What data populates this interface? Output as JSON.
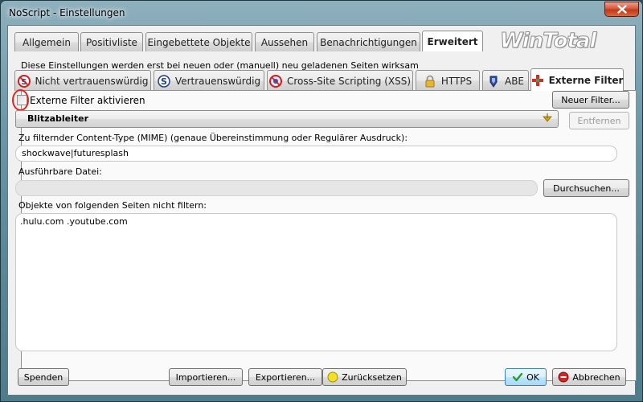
{
  "window": {
    "title": "NoScript - Einstellungen",
    "close_icon": "close-icon"
  },
  "logo_text": "WinTotal",
  "main_tabs": [
    {
      "label": "Allgemein",
      "active": false
    },
    {
      "label": "Positivliste",
      "active": false
    },
    {
      "label": "Eingebettete Objekte",
      "active": false
    },
    {
      "label": "Aussehen",
      "active": false
    },
    {
      "label": "Benachrichtigungen",
      "active": false
    },
    {
      "label": "Erweitert",
      "active": true
    }
  ],
  "info_text": "Diese Einstellungen werden erst bei neuen oder (manuell) neu geladenen Seiten wirksam",
  "sub_tabs": [
    {
      "label": "Nicht vertrauenswürdig",
      "icon": "untrusted-icon",
      "active": false
    },
    {
      "label": "Vertrauenswürdig",
      "icon": "trusted-icon",
      "active": false
    },
    {
      "label": "Cross-Site Scripting (XSS)",
      "icon": "xss-icon",
      "active": false
    },
    {
      "label": "HTTPS",
      "icon": "lock-icon",
      "active": false
    },
    {
      "label": "ABE",
      "icon": "abe-icon",
      "active": false
    },
    {
      "label": "Externe Filter",
      "icon": "filter-plus-icon",
      "active": true
    }
  ],
  "external_filters": {
    "enable_label": "Externe Filter aktivieren",
    "enabled": false,
    "new_filter_button": "Neuer Filter...",
    "selected_filter": "Blitzableiter",
    "remove_button": "Entfernen",
    "mime_label": "Zu filternder Content-Type (MIME) (genaue Übereinstimmung oder Regulärer Ausdruck):",
    "mime_value": "shockwave|futuresplash",
    "executable_label": "Ausführbare Datei:",
    "executable_value": "",
    "browse_button": "Durchsuchen...",
    "exceptions_label": "Objekte von folgenden Seiten nicht filtern:",
    "exceptions_value": ".hulu.com .youtube.com"
  },
  "footer": {
    "donate_button": "Spenden",
    "import_button": "Importieren...",
    "export_button": "Exportieren...",
    "reset_button": "Zurücksetzen",
    "ok_button": "OK",
    "cancel_button": "Abbrechen"
  },
  "colors": {
    "accent_red": "#e0261b",
    "ok_blue": "#3c7fb1"
  }
}
